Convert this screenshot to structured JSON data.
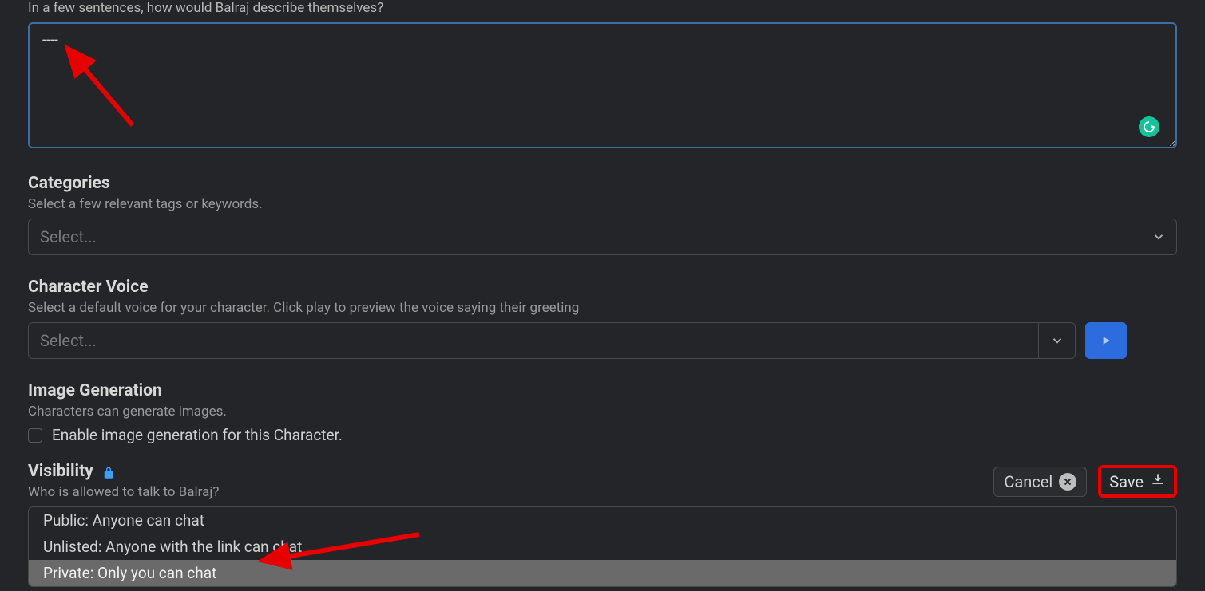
{
  "description": {
    "question": "In a few sentences, how would Balraj describe themselves?",
    "value": "----"
  },
  "categories": {
    "title": "Categories",
    "sub": "Select a few relevant tags or keywords.",
    "placeholder": "Select..."
  },
  "voice": {
    "title": "Character Voice",
    "sub": "Select a default voice for your character. Click play to preview the voice saying their greeting",
    "placeholder": "Select..."
  },
  "imageGen": {
    "title": "Image Generation",
    "sub": "Characters can generate images.",
    "checkboxLabel": "Enable image generation for this Character."
  },
  "visibility": {
    "title": "Visibility",
    "sub": "Who is allowed to talk to Balraj?",
    "options": [
      "Public: Anyone can chat",
      "Unlisted: Anyone with the link can chat",
      "Private: Only you can chat"
    ]
  },
  "buttons": {
    "cancel": "Cancel",
    "save": "Save"
  }
}
